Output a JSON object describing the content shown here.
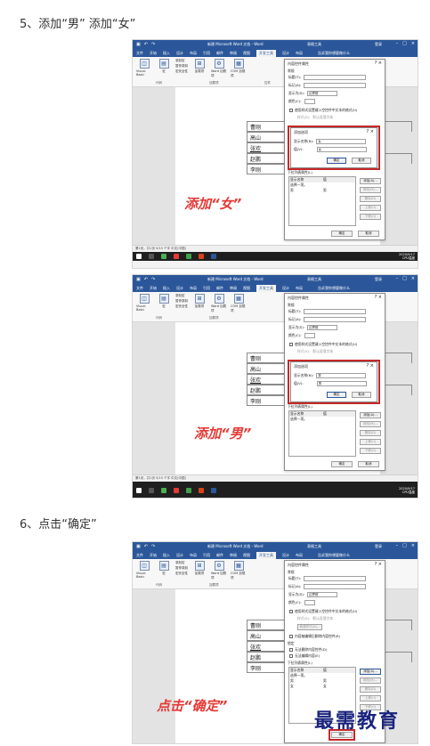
{
  "steps": [
    {
      "title": "5、添加“男” 添加“女”"
    },
    {
      "title": "6、点击“确定”"
    }
  ],
  "word": {
    "doc_title": "新建 Microsoft Word 文档 - Word",
    "context_title": "表格工具",
    "login": "登录",
    "menu": [
      "文件",
      "开始",
      "插入",
      "设计",
      "布局",
      "引用",
      "邮件",
      "审阅",
      "视图",
      "开发工具",
      "设计",
      "布局"
    ],
    "tell_me": "告诉我你想要做什么",
    "ribbon": {
      "visual_basic": "Visual Basic",
      "macro": "宏",
      "record_macro": "录制宏",
      "pause_record": "暂停录制",
      "macro_security": "宏安全性",
      "code_group": "代码",
      "addin": "加载项",
      "word_addin": "Word 加载项",
      "com_addin": "COM 加载项",
      "addin_group": "加载项",
      "controls_group": "控件"
    },
    "status": "第1页，共1页  5/15 个字  中文(中国)",
    "time": "2020/9/17",
    "weather": "CPU温度"
  },
  "table_cells": [
    "曹刚",
    "高山",
    "张欢",
    "赵鹏",
    "李刚"
  ],
  "dialog": {
    "title": "内容控件属性",
    "general": "常规",
    "title_label": "标题(T):",
    "tag_label": "标记(A):",
    "show_as_label": "显示为(S):",
    "show_as_value": "边界框",
    "color_label": "颜色(C):",
    "style_check": "使用样式设置键入空控件中文本的格式(U)",
    "style_label": "样式(S):",
    "style_value": "默认段落字体",
    "new_style": "新建样式(N)...",
    "remove_check": "内容被编辑后删除内容控件(R)",
    "lock_label": "锁定",
    "lock1": "无法删除内容控件(D)",
    "lock2": "无法编辑内容(E)",
    "list_props": "下拉列表属性(L)",
    "col_display": "显示名称",
    "col_value": "值",
    "add": "添加(A)...",
    "modify": "修改(M)...",
    "delete": "删除(D)",
    "move_up": "上移(U)",
    "move_down": "下移(O)",
    "ok": "确定",
    "cancel": "取消"
  },
  "add_option": {
    "title": "添加选项",
    "help": "?",
    "close": "×",
    "display_label": "显示名称(N):",
    "value_label": "值(V):",
    "ok": "确定",
    "cancel": "取消"
  },
  "shot1": {
    "caption": "添加“女”",
    "display_value": "女",
    "value_value": "女",
    "list": [
      [
        "选择一项。",
        ""
      ],
      [
        "男",
        "男"
      ]
    ]
  },
  "shot2": {
    "caption": "添加“男”",
    "display_value": "男",
    "value_value": "男",
    "list": [
      [
        "选择一项。",
        ""
      ]
    ]
  },
  "shot3": {
    "caption": "点击“确定”",
    "list": [
      [
        "选择一项。",
        ""
      ],
      [
        "男",
        "男"
      ],
      [
        "女",
        "女"
      ]
    ]
  },
  "watermark": "最需教育"
}
